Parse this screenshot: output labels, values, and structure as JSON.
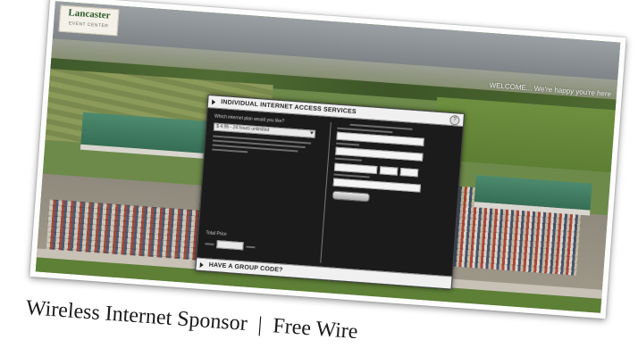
{
  "site": {
    "logo_main": "Lancaster",
    "logo_sub": "EVENT CENTER",
    "welcome": "WELCOME... We're happy you're here"
  },
  "modal": {
    "title": "INDIVIDUAL INTERNET ACCESS SERVICES",
    "help": "?",
    "question": "Which internet plan would you like?",
    "plan_selected": "$ 4.95 - 24 hours unlimited",
    "total_label": "Total Price",
    "footer": "HAVE A GROUP CODE?"
  },
  "caption": {
    "left": "Wireless Internet Sponsor",
    "separator": "|",
    "right": "Free Wire"
  }
}
